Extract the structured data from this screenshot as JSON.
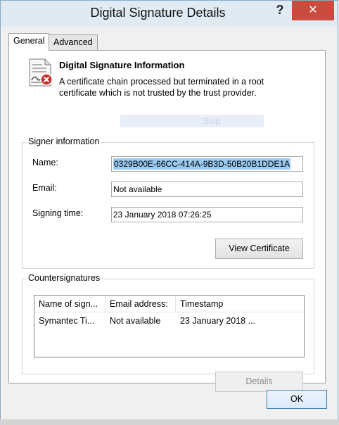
{
  "window": {
    "title": "Digital Signature Details",
    "help_label": "?",
    "close_label": "✕"
  },
  "tabs": [
    {
      "label": "General",
      "selected": true
    },
    {
      "label": "Advanced",
      "selected": false
    }
  ],
  "info": {
    "heading": "Digital Signature Information",
    "text": "A certificate chain processed but terminated in a root certificate which is not trusted by the trust provider.",
    "icon": "certificate-warning-icon",
    "ghost_text": "Snip"
  },
  "signer": {
    "group_title": "Signer information",
    "name_label": "Name:",
    "name_value": "0329B00E-66CC-414A-9B3D-50B20B1DDE1A",
    "email_label": "Email:",
    "email_value": "Not available",
    "time_label": "Signing time:",
    "time_value": "23 January 2018 07:26:25",
    "view_cert_label": "View Certificate"
  },
  "countersignatures": {
    "group_title": "Countersignatures",
    "columns": [
      "Name of sign...",
      "Email address:",
      "Timestamp"
    ],
    "rows": [
      [
        "Symantec Ti...",
        "Not available",
        "23 January 2018 ..."
      ]
    ],
    "details_label": "Details"
  },
  "ok_label": "OK",
  "colors": {
    "selection": "#99c9ef",
    "close_button": "#c94c3e",
    "frame": "#dfeaf3"
  }
}
